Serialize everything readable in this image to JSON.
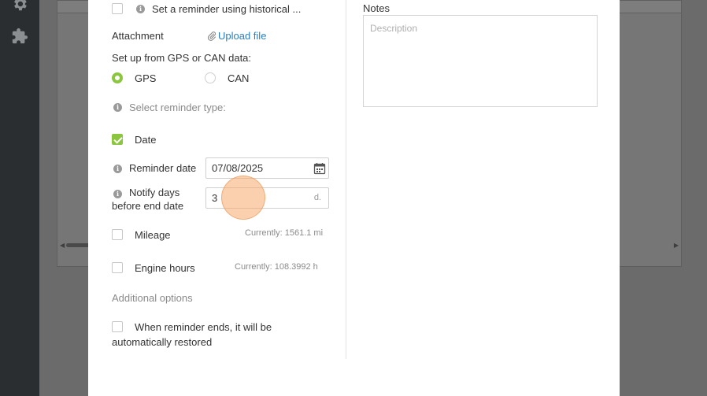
{
  "sidebar": {
    "icons": [
      "gear-icon",
      "puzzle-icon"
    ]
  },
  "form": {
    "historical_reminder_label": "Set a reminder using historical ...",
    "attachment_label": "Attachment",
    "upload_label": "Upload file",
    "source_label": "Set up from GPS or CAN data:",
    "gps_label": "GPS",
    "can_label": "CAN",
    "source_selected": "GPS",
    "reminder_type_label": "Select reminder type:",
    "date_label": "Date",
    "date_checked": true,
    "reminder_date_label": "Reminder date",
    "reminder_date_value": "07/08/2025",
    "notify_days_label_line1": "Notify days",
    "notify_days_label_line2": "before end date",
    "notify_days_value": "3",
    "notify_days_unit": "d.",
    "mileage_label": "Mileage",
    "mileage_current": "Currently: 1561.1 mi",
    "engine_hours_label": "Engine hours",
    "engine_hours_current": "Currently: 108.3992 h",
    "additional_options_label": "Additional options",
    "restore_label_line1": "When reminder ends, it will be",
    "restore_label_line2": "automatically restored"
  },
  "notes": {
    "label": "Notes",
    "placeholder": "Description"
  },
  "colors": {
    "accent": "#8cc63f",
    "link": "#2a7fc0",
    "sidebar": "#2a2e31"
  }
}
